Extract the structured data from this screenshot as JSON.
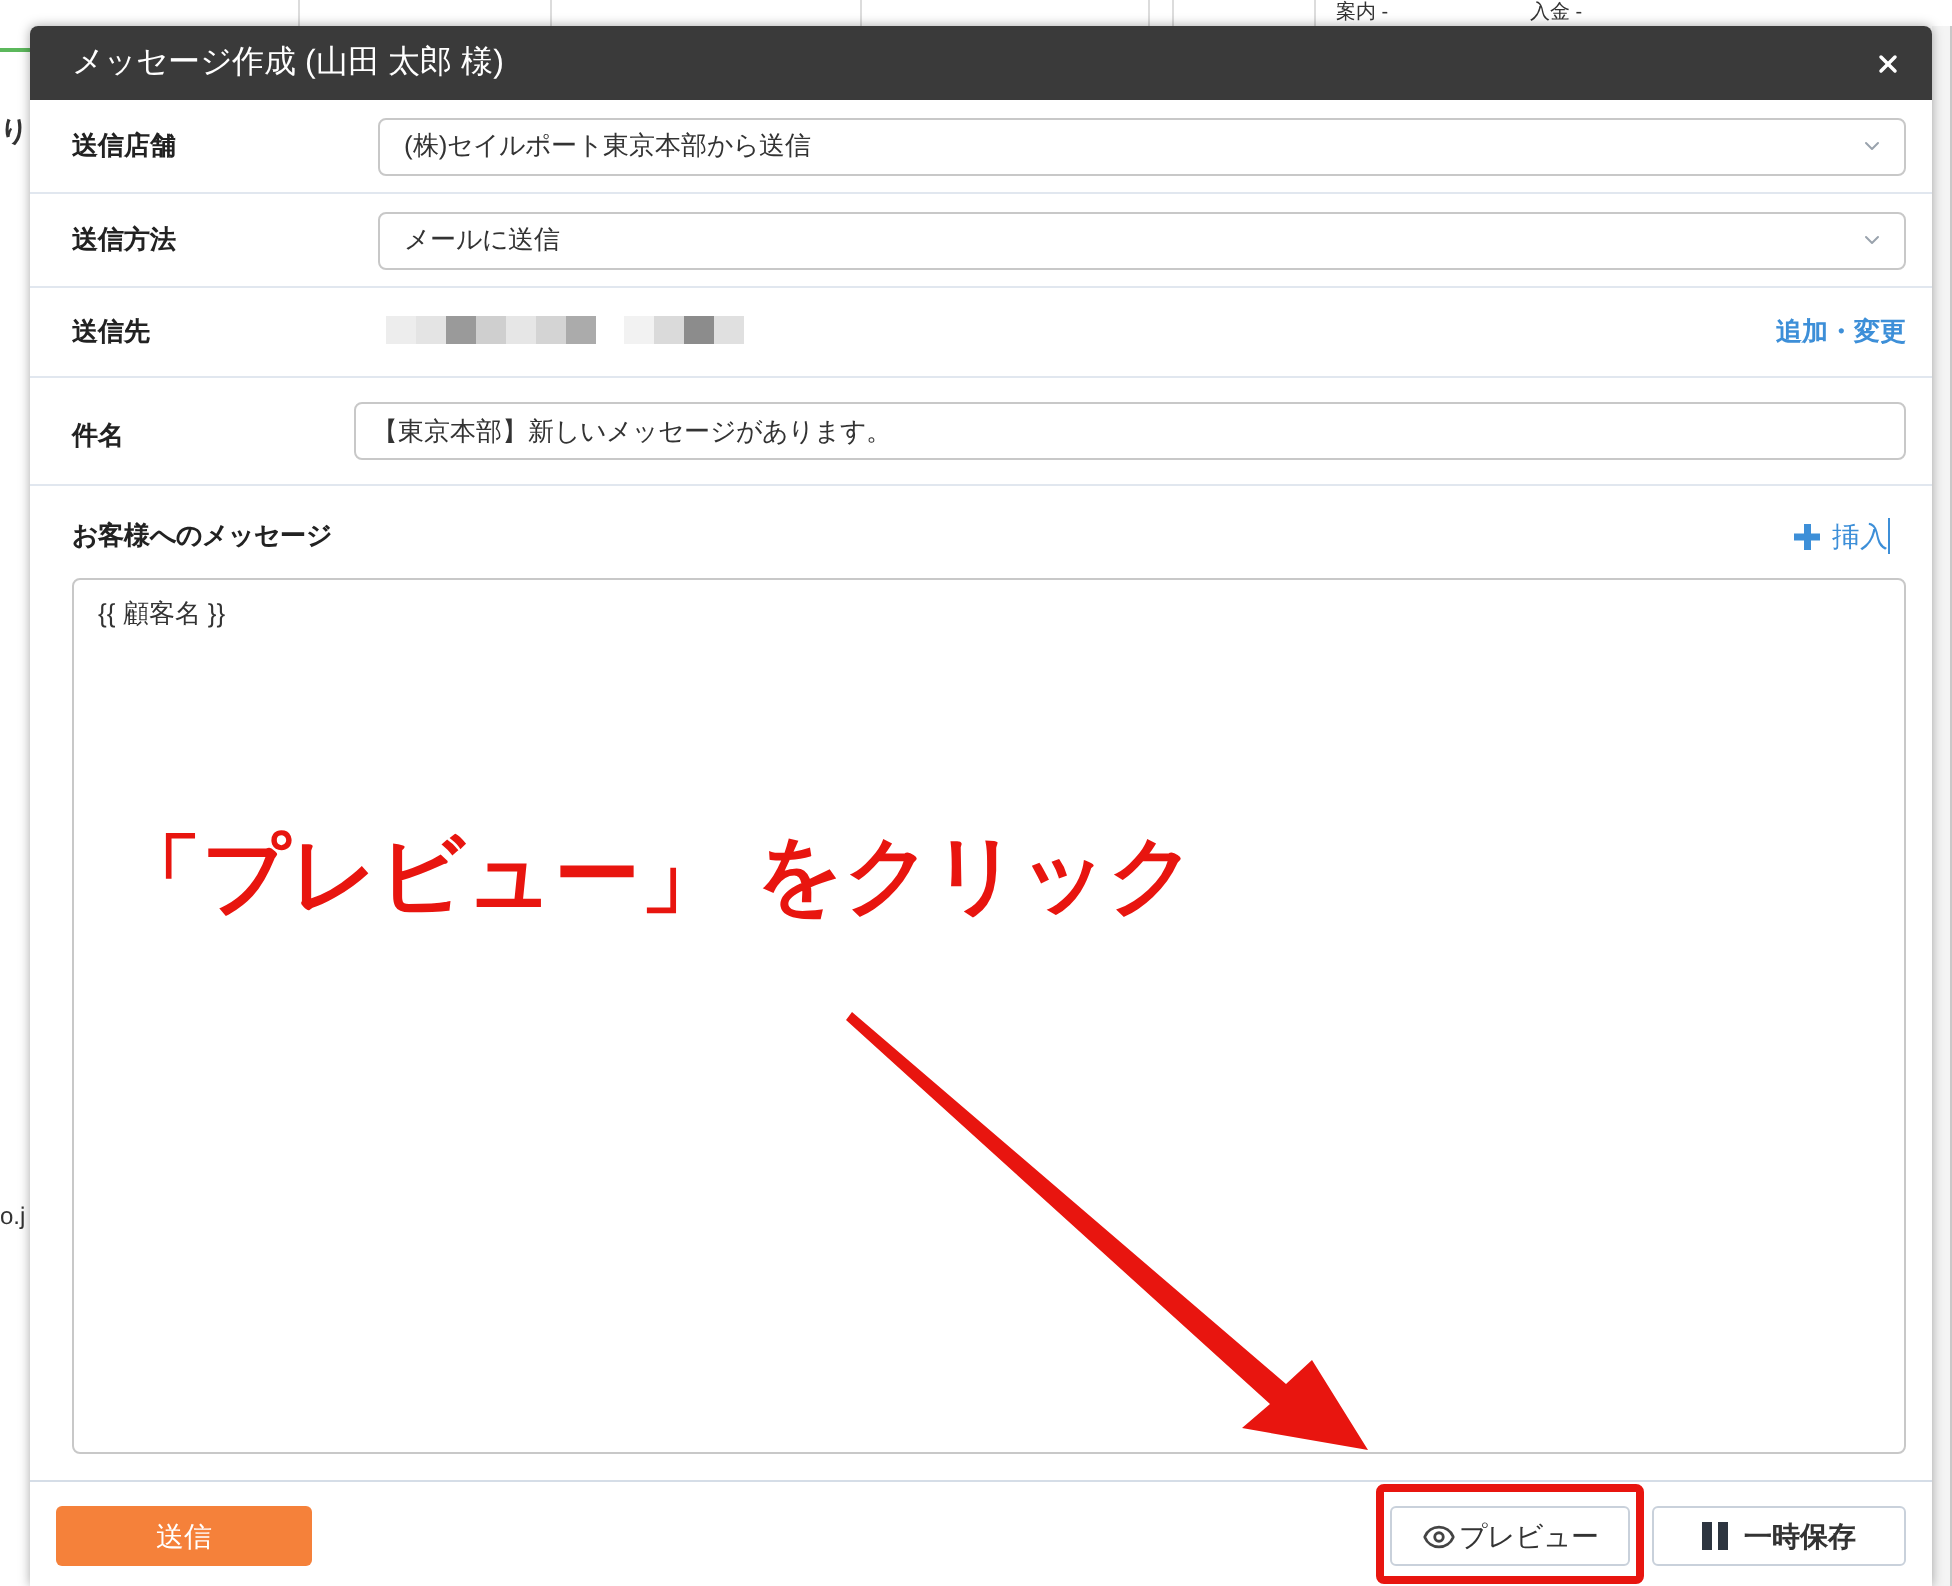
{
  "background": {
    "table_cells": [
      "案内 -",
      "入金 -"
    ],
    "side_texts": [
      "り",
      "o.j"
    ]
  },
  "dialog": {
    "title": "メッセージ作成 (山田 太郎 様)",
    "fields": [
      {
        "kind": "select",
        "label": "送信店舗",
        "value": "(株)セイルポート東京本部から送信"
      },
      {
        "kind": "select",
        "label": "送信方法",
        "value": "メールに送信"
      },
      {
        "kind": "recipients",
        "label": "送信先",
        "link": "追加・変更"
      },
      {
        "kind": "text",
        "label": "件名",
        "value": "【東京本部】新しいメッセージがあります。"
      }
    ],
    "message": {
      "label": "お客様へのメッセージ",
      "insert": "挿入",
      "value": "{{ 顧客名 }}"
    },
    "buttons": [
      {
        "kind": "send",
        "label": "送信",
        "highlighted": false
      },
      {
        "kind": "preview",
        "label": "プレビュー",
        "highlighted": true
      },
      {
        "kind": "save",
        "label": "一時保存",
        "highlighted": false
      }
    ]
  },
  "annotation": {
    "text": "「プレビュー」 をクリック"
  }
}
